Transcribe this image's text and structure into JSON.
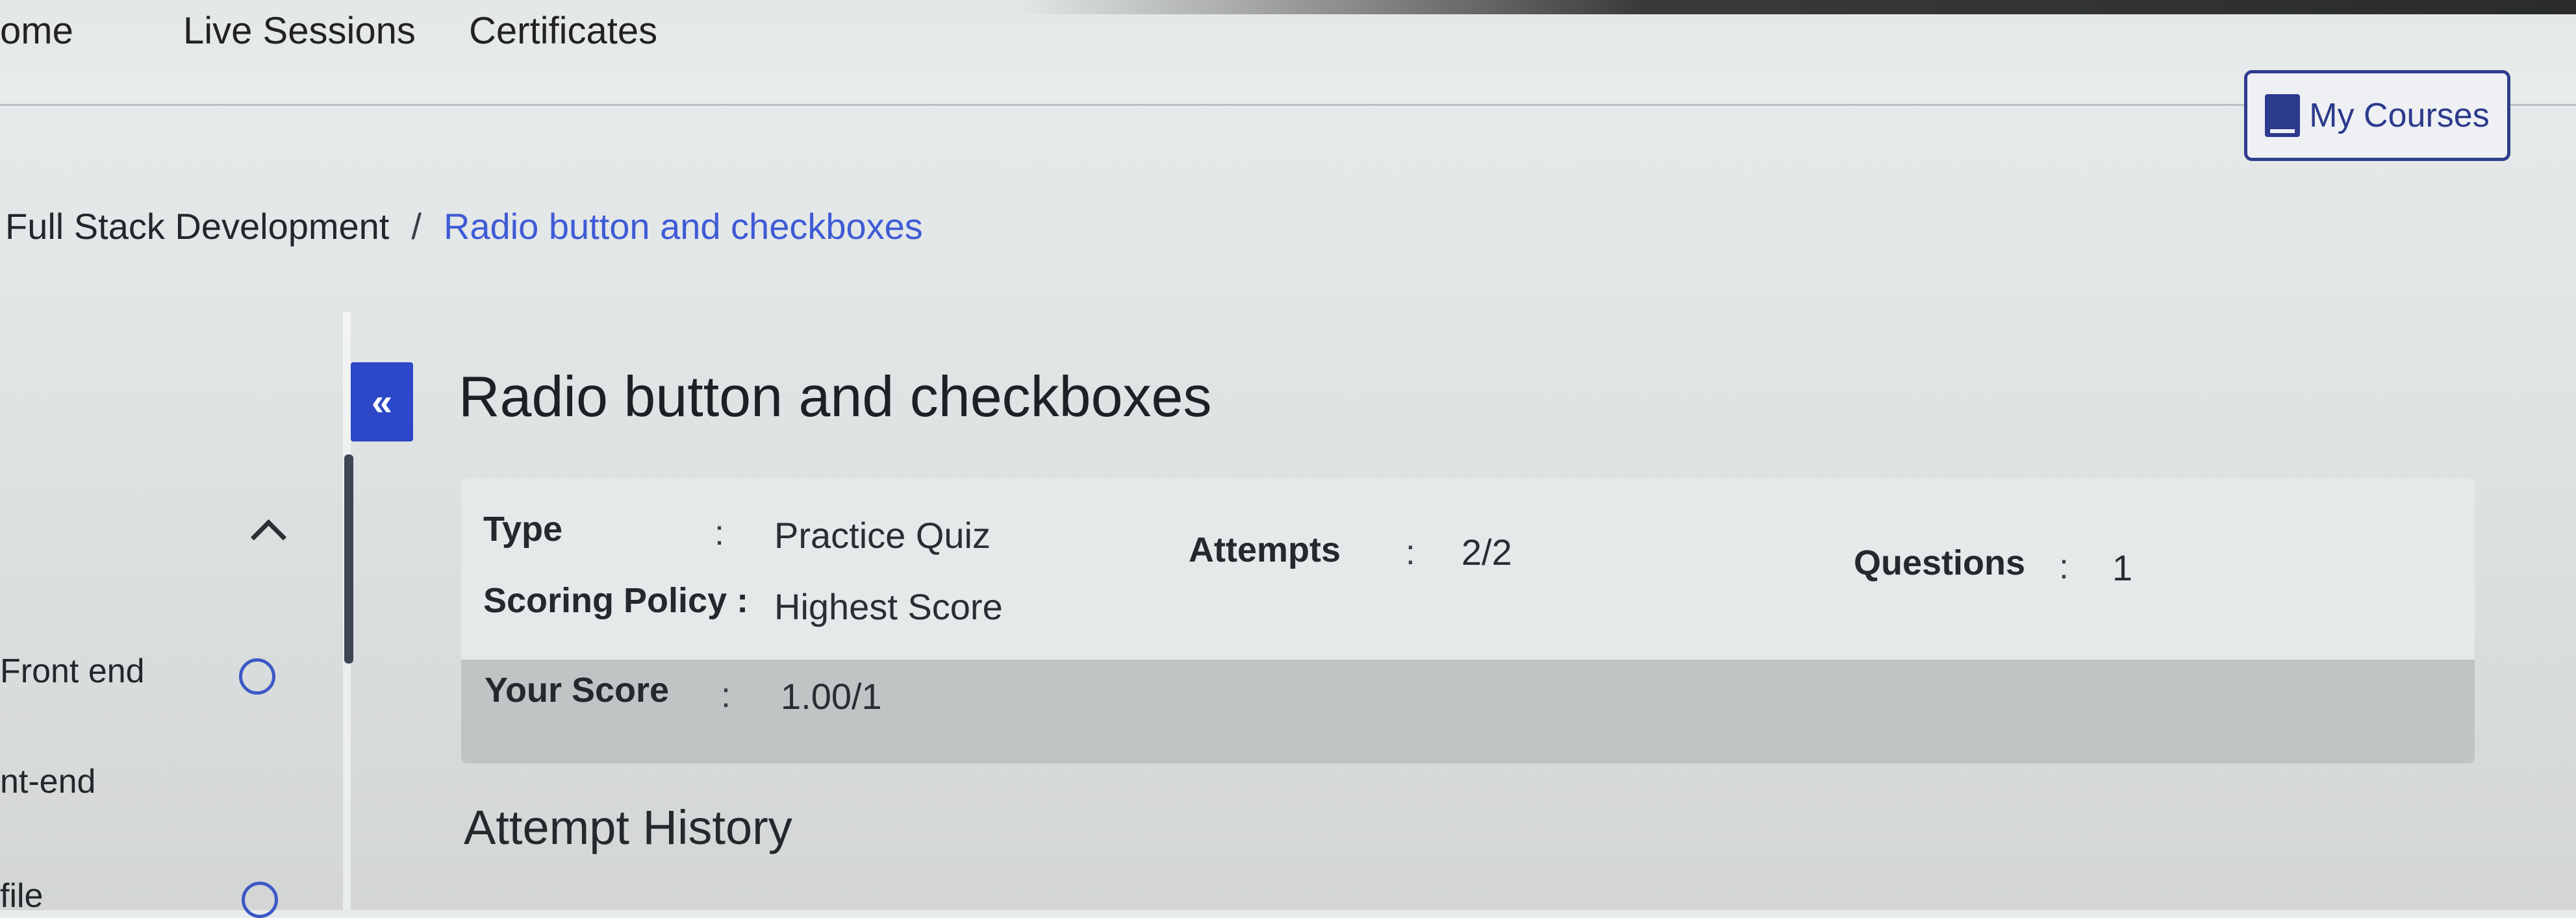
{
  "nav": {
    "home": "ome",
    "live_sessions": "Live Sessions",
    "certificates": "Certificates",
    "my_courses": "My Courses"
  },
  "breadcrumb": {
    "course": "Full Stack Development",
    "separator": "/",
    "current": "Radio button and checkboxes"
  },
  "sidebar": {
    "collapse_label": "«",
    "items": [
      {
        "label": "Front end"
      },
      {
        "label": "nt-end"
      },
      {
        "label": "file"
      }
    ]
  },
  "quiz": {
    "title": "Radio button and checkboxes",
    "type_label": "Type",
    "type_value": "Practice Quiz",
    "attempts_label": "Attempts",
    "attempts_value": "2/2",
    "questions_label": "Questions",
    "questions_value": "1",
    "scoring_label": "Scoring Policy :",
    "scoring_value": "Highest Score",
    "score_label": "Your Score",
    "score_value": "1.00/1",
    "colon": ":"
  },
  "history": {
    "title": "Attempt History"
  },
  "colors": {
    "accent": "#2c47c7",
    "link": "#3e5bd6"
  }
}
